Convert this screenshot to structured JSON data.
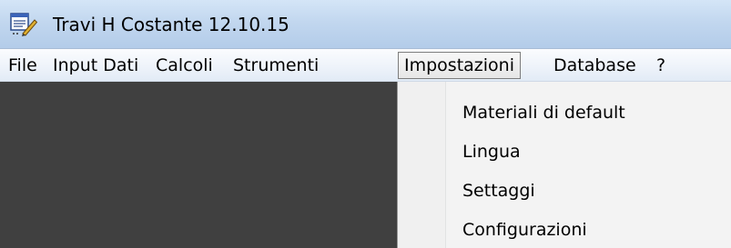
{
  "window": {
    "title": "Travi H Costante 12.10.15",
    "icon": "notepad-pencil-icon"
  },
  "menubar": {
    "items": [
      {
        "label": "File"
      },
      {
        "label": "Input Dati"
      },
      {
        "label": "Calcoli"
      },
      {
        "label": "Strumenti"
      },
      {
        "label": "Impostazioni",
        "open": true
      },
      {
        "label": "Database"
      },
      {
        "label": "?"
      }
    ]
  },
  "dropdown": {
    "items": [
      {
        "label": "Materiali di default"
      },
      {
        "label": "Lingua"
      },
      {
        "label": "Settaggi"
      },
      {
        "label": "Configurazioni"
      }
    ]
  },
  "colors": {
    "workspace": "#404040",
    "titlebar": "#c2d7ef",
    "menubar": "#eef3fa",
    "dropdown": "#f3f3f3"
  }
}
